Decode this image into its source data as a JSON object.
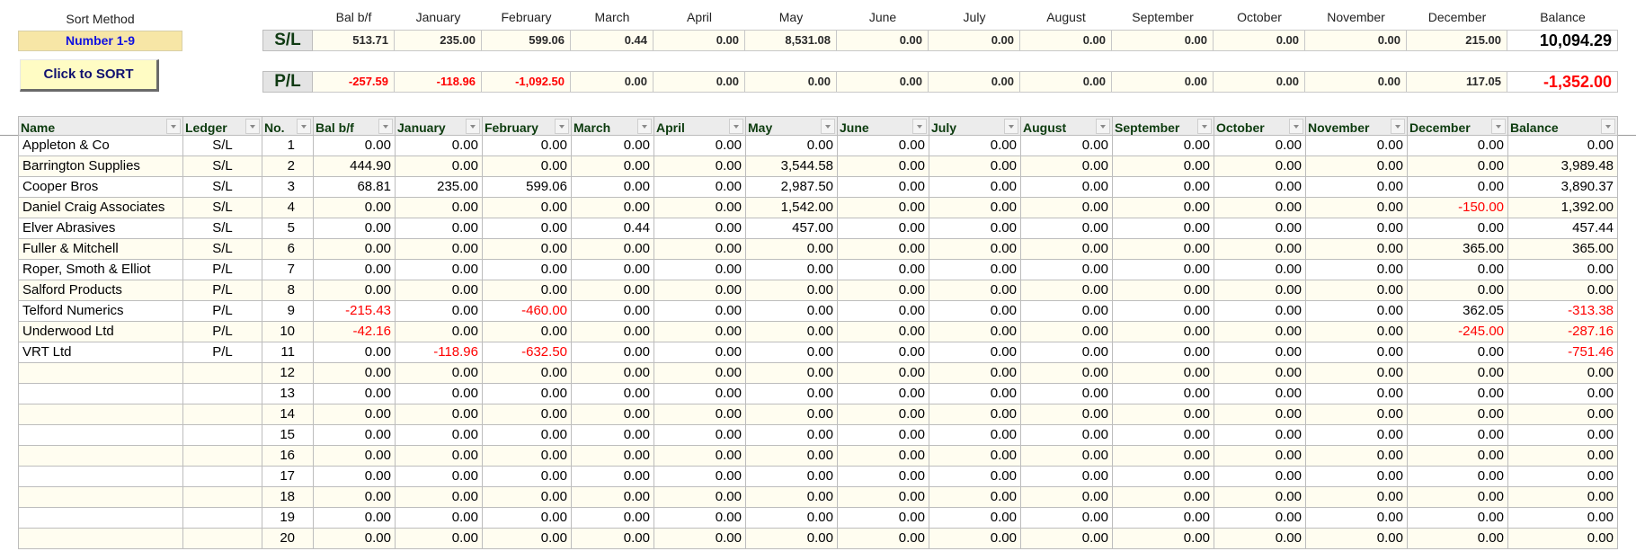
{
  "sort": {
    "label": "Sort Method",
    "method": "Number 1-9",
    "button_label": "Click to SORT"
  },
  "summary": {
    "column_labels": [
      "Bal b/f",
      "January",
      "February",
      "March",
      "April",
      "May",
      "June",
      "July",
      "August",
      "September",
      "October",
      "November",
      "December",
      "Balance"
    ],
    "rows": [
      {
        "tag": "S/L",
        "values": [
          "513.71",
          "235.00",
          "599.06",
          "0.44",
          "0.00",
          "8,531.08",
          "0.00",
          "0.00",
          "0.00",
          "0.00",
          "0.00",
          "0.00",
          "215.00",
          "10,094.29"
        ]
      },
      {
        "tag": "P/L",
        "values": [
          "-257.59",
          "-118.96",
          "-1,092.50",
          "0.00",
          "0.00",
          "0.00",
          "0.00",
          "0.00",
          "0.00",
          "0.00",
          "0.00",
          "0.00",
          "117.05",
          "-1,352.00"
        ]
      }
    ]
  },
  "table": {
    "columns": [
      "Name",
      "Ledger",
      "No.",
      "Bal b/f",
      "January",
      "February",
      "March",
      "April",
      "May",
      "June",
      "July",
      "August",
      "September",
      "October",
      "November",
      "December",
      "Balance"
    ],
    "rows": [
      [
        "Appleton & Co",
        "S/L",
        "1",
        "0.00",
        "0.00",
        "0.00",
        "0.00",
        "0.00",
        "0.00",
        "0.00",
        "0.00",
        "0.00",
        "0.00",
        "0.00",
        "0.00",
        "0.00",
        "0.00"
      ],
      [
        "Barrington Supplies",
        "S/L",
        "2",
        "444.90",
        "0.00",
        "0.00",
        "0.00",
        "0.00",
        "3,544.58",
        "0.00",
        "0.00",
        "0.00",
        "0.00",
        "0.00",
        "0.00",
        "0.00",
        "3,989.48"
      ],
      [
        "Cooper Bros",
        "S/L",
        "3",
        "68.81",
        "235.00",
        "599.06",
        "0.00",
        "0.00",
        "2,987.50",
        "0.00",
        "0.00",
        "0.00",
        "0.00",
        "0.00",
        "0.00",
        "0.00",
        "3,890.37"
      ],
      [
        "Daniel Craig Associates",
        "S/L",
        "4",
        "0.00",
        "0.00",
        "0.00",
        "0.00",
        "0.00",
        "1,542.00",
        "0.00",
        "0.00",
        "0.00",
        "0.00",
        "0.00",
        "0.00",
        "-150.00",
        "1,392.00"
      ],
      [
        "Elver Abrasives",
        "S/L",
        "5",
        "0.00",
        "0.00",
        "0.00",
        "0.44",
        "0.00",
        "457.00",
        "0.00",
        "0.00",
        "0.00",
        "0.00",
        "0.00",
        "0.00",
        "0.00",
        "457.44"
      ],
      [
        "Fuller & Mitchell",
        "S/L",
        "6",
        "0.00",
        "0.00",
        "0.00",
        "0.00",
        "0.00",
        "0.00",
        "0.00",
        "0.00",
        "0.00",
        "0.00",
        "0.00",
        "0.00",
        "365.00",
        "365.00"
      ],
      [
        "Roper, Smoth & Elliot",
        "P/L",
        "7",
        "0.00",
        "0.00",
        "0.00",
        "0.00",
        "0.00",
        "0.00",
        "0.00",
        "0.00",
        "0.00",
        "0.00",
        "0.00",
        "0.00",
        "0.00",
        "0.00"
      ],
      [
        "Salford Products",
        "P/L",
        "8",
        "0.00",
        "0.00",
        "0.00",
        "0.00",
        "0.00",
        "0.00",
        "0.00",
        "0.00",
        "0.00",
        "0.00",
        "0.00",
        "0.00",
        "0.00",
        "0.00"
      ],
      [
        "Telford Numerics",
        "P/L",
        "9",
        "-215.43",
        "0.00",
        "-460.00",
        "0.00",
        "0.00",
        "0.00",
        "0.00",
        "0.00",
        "0.00",
        "0.00",
        "0.00",
        "0.00",
        "362.05",
        "-313.38"
      ],
      [
        "Underwood Ltd",
        "P/L",
        "10",
        "-42.16",
        "0.00",
        "0.00",
        "0.00",
        "0.00",
        "0.00",
        "0.00",
        "0.00",
        "0.00",
        "0.00",
        "0.00",
        "0.00",
        "-245.00",
        "-287.16"
      ],
      [
        "VRT Ltd",
        "P/L",
        "11",
        "0.00",
        "-118.96",
        "-632.50",
        "0.00",
        "0.00",
        "0.00",
        "0.00",
        "0.00",
        "0.00",
        "0.00",
        "0.00",
        "0.00",
        "0.00",
        "-751.46"
      ],
      [
        "",
        "",
        "12",
        "0.00",
        "0.00",
        "0.00",
        "0.00",
        "0.00",
        "0.00",
        "0.00",
        "0.00",
        "0.00",
        "0.00",
        "0.00",
        "0.00",
        "0.00",
        "0.00"
      ],
      [
        "",
        "",
        "13",
        "0.00",
        "0.00",
        "0.00",
        "0.00",
        "0.00",
        "0.00",
        "0.00",
        "0.00",
        "0.00",
        "0.00",
        "0.00",
        "0.00",
        "0.00",
        "0.00"
      ],
      [
        "",
        "",
        "14",
        "0.00",
        "0.00",
        "0.00",
        "0.00",
        "0.00",
        "0.00",
        "0.00",
        "0.00",
        "0.00",
        "0.00",
        "0.00",
        "0.00",
        "0.00",
        "0.00"
      ],
      [
        "",
        "",
        "15",
        "0.00",
        "0.00",
        "0.00",
        "0.00",
        "0.00",
        "0.00",
        "0.00",
        "0.00",
        "0.00",
        "0.00",
        "0.00",
        "0.00",
        "0.00",
        "0.00"
      ],
      [
        "",
        "",
        "16",
        "0.00",
        "0.00",
        "0.00",
        "0.00",
        "0.00",
        "0.00",
        "0.00",
        "0.00",
        "0.00",
        "0.00",
        "0.00",
        "0.00",
        "0.00",
        "0.00"
      ],
      [
        "",
        "",
        "17",
        "0.00",
        "0.00",
        "0.00",
        "0.00",
        "0.00",
        "0.00",
        "0.00",
        "0.00",
        "0.00",
        "0.00",
        "0.00",
        "0.00",
        "0.00",
        "0.00"
      ],
      [
        "",
        "",
        "18",
        "0.00",
        "0.00",
        "0.00",
        "0.00",
        "0.00",
        "0.00",
        "0.00",
        "0.00",
        "0.00",
        "0.00",
        "0.00",
        "0.00",
        "0.00",
        "0.00"
      ],
      [
        "",
        "",
        "19",
        "0.00",
        "0.00",
        "0.00",
        "0.00",
        "0.00",
        "0.00",
        "0.00",
        "0.00",
        "0.00",
        "0.00",
        "0.00",
        "0.00",
        "0.00",
        "0.00"
      ],
      [
        "",
        "",
        "20",
        "0.00",
        "0.00",
        "0.00",
        "0.00",
        "0.00",
        "0.00",
        "0.00",
        "0.00",
        "0.00",
        "0.00",
        "0.00",
        "0.00",
        "0.00",
        "0.00"
      ]
    ]
  },
  "colors": {
    "negative": "#ff0000",
    "header_text": "#0c3b0e",
    "sort_method_text": "#1010e0",
    "row_alt": "#fffdf0"
  }
}
